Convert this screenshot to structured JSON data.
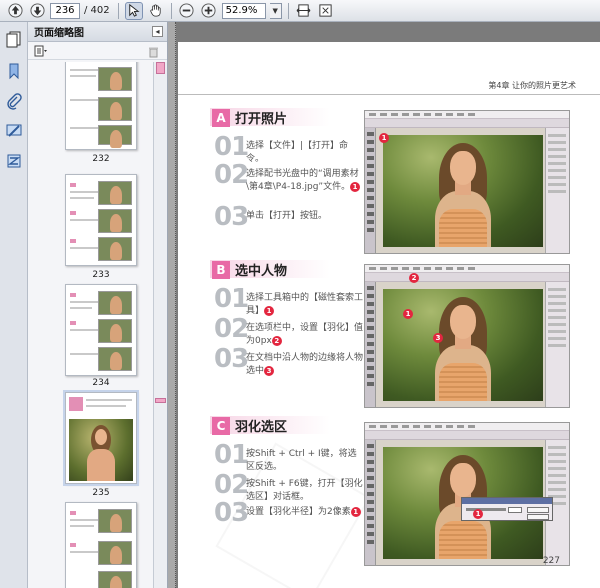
{
  "toolbar": {
    "current_page": "236",
    "total_pages": "/ 402",
    "zoom": "52.9%"
  },
  "sidebar": {
    "panel_title": "页面缩略图",
    "close_glyph": "◂",
    "thumbnails": [
      {
        "label": "232"
      },
      {
        "label": "233"
      },
      {
        "label": "234"
      },
      {
        "label": "235"
      }
    ]
  },
  "document": {
    "chapter_header": "第4章  让你的照片更艺术",
    "page_number": "227",
    "sections": [
      {
        "letter": "A",
        "title": "打开照片",
        "steps": [
          {
            "num": "01",
            "text": "选择【文件】|【打开】命令。"
          },
          {
            "num": "02",
            "text": "选择配书光盘中的“调用素材\\第4章\\P4-18.jpg”文件。",
            "badge": "1"
          },
          {
            "num": "03",
            "text": "单击【打开】按钮。"
          }
        ],
        "markers": [
          "1"
        ]
      },
      {
        "letter": "B",
        "title": "选中人物",
        "steps": [
          {
            "num": "01",
            "text": "选择工具箱中的【磁性套索工具】",
            "badge": "1"
          },
          {
            "num": "02",
            "text": "在选项栏中，设置【羽化】值为0px",
            "badge": "2"
          },
          {
            "num": "03",
            "text": "在文档中沿人物的边缘将人物选中",
            "badge": "3"
          }
        ],
        "markers": [
          "2",
          "1",
          "3"
        ]
      },
      {
        "letter": "C",
        "title": "羽化选区",
        "steps": [
          {
            "num": "01",
            "text": "按Shift + Ctrl + I键，将选区反选。"
          },
          {
            "num": "02",
            "text": "按Shift + F6键，打开【羽化选区】对话框。"
          },
          {
            "num": "03",
            "text": "设置【羽化半径】为2像素",
            "badge": "1"
          }
        ],
        "markers": [
          "1"
        ]
      }
    ]
  },
  "colors": {
    "accent_pink": "#e86aa6",
    "marker_red": "#e3263f"
  }
}
